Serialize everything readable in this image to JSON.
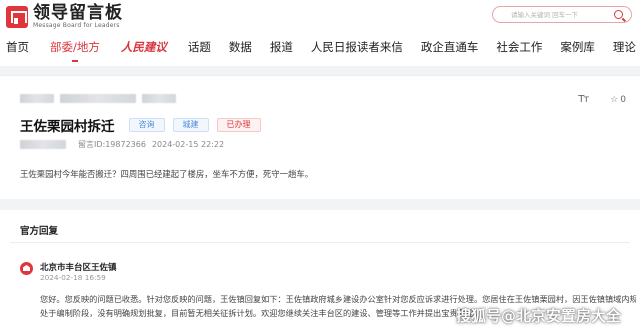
{
  "logo": {
    "title": "领导留言板",
    "subtitle": "Message Board for Leaders"
  },
  "search": {
    "placeholder": "请输入关键词 回车一下"
  },
  "nav": {
    "items": [
      {
        "label": "首页"
      },
      {
        "label": "部委/地方",
        "active": true
      },
      {
        "label": "人民建议",
        "brand": true
      },
      {
        "label": "话题"
      },
      {
        "label": "数据"
      },
      {
        "label": "报道"
      },
      {
        "label": "人民日报读者来信"
      },
      {
        "label": "政企直通车"
      },
      {
        "label": "社会工作"
      },
      {
        "label": "案例库"
      },
      {
        "label": "理论"
      }
    ]
  },
  "message": {
    "tools": {
      "font_label": "Tт",
      "fav_count": "0"
    },
    "title": "王佐栗园村拆迁",
    "tags": [
      "咨询",
      "城建",
      "已办理"
    ],
    "id_text": "留言ID:19872366",
    "time": "2024-02-15 22:22",
    "content": "王佐栗园村今年能否搬迁？四周围已经建起了楼房，坐车不方便，死守一趟车。"
  },
  "reply": {
    "header": "官方回复",
    "org_name": "北京市丰台区王佐镇",
    "time": "2024-02-18 16:59",
    "line1": "您好。您反映的问题已收悉。针对您反映的问题，王佐镇回复如下：王佐镇政府城乡建设办公室针对您反应诉求进行处理。您居住在王佐镇栗园村，因王佐镇镇域内规划仍然",
    "line2": "处于编制阶段，没有明确规划批复，目前暂无相关征拆计划。欢迎您继续关注丰台区的建设、管理等工作并提出宝贵意见。"
  },
  "watermark": "搜狐号@北京安置房大全",
  "colors": {
    "accent": "#d9363e",
    "tag_blue": "#4a8bd9",
    "background": "#f2f3f5"
  },
  "icons": [
    "logo-icon",
    "search-icon",
    "font-size-icon",
    "star-icon",
    "org-avatar-icon"
  ]
}
